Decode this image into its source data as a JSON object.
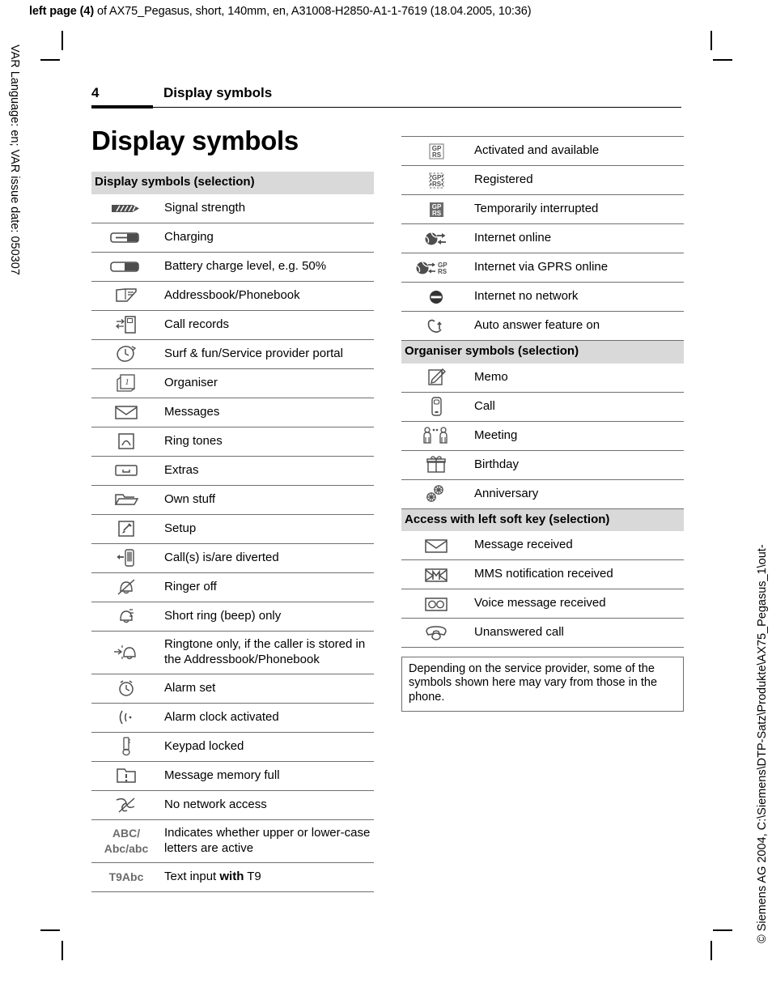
{
  "slug": {
    "prefix_bold": "left page (4)",
    "rest": " of AX75_Pegasus, short, 140mm, en, A31008-H2850-A1-1-7619 (18.04.2005, 10:36)"
  },
  "side": {
    "left": "VAR Language: en; VAR issue date: 050307",
    "right": "© Siemens AG 2004, C:\\Siemens\\DTP-Satz\\Produkte\\AX75_Pegasus_1\\out-"
  },
  "running_head": {
    "page_number": "4",
    "title": "Display symbols"
  },
  "page_title": "Display symbols",
  "colors": {
    "section_header_bg": "#d9d9d9",
    "rule": "#6f6f6f",
    "symbol_text": "#6b6b6b",
    "icon_dark": "#4d4d4d"
  },
  "left_column": {
    "section": "Display symbols (selection)",
    "rows": [
      {
        "icon": "signal-strength-icon",
        "label": "Signal strength"
      },
      {
        "icon": "charging-icon",
        "label": "Charging"
      },
      {
        "icon": "battery-level-icon",
        "label": "Battery charge level, e.g. 50%"
      },
      {
        "icon": "addressbook-icon",
        "label": "Addressbook/Phonebook"
      },
      {
        "icon": "call-records-icon",
        "label": "Call records"
      },
      {
        "icon": "surf-fun-icon",
        "label": "Surf & fun/Service provider portal"
      },
      {
        "icon": "organiser-icon",
        "label": "Organiser"
      },
      {
        "icon": "messages-icon",
        "label": "Messages"
      },
      {
        "icon": "ring-tones-icon",
        "label": "Ring tones"
      },
      {
        "icon": "extras-icon",
        "label": "Extras"
      },
      {
        "icon": "own-stuff-icon",
        "label": "Own stuff"
      },
      {
        "icon": "setup-icon",
        "label": "Setup"
      },
      {
        "icon": "call-diverted-icon",
        "label": "Call(s) is/are diverted"
      },
      {
        "icon": "ringer-off-icon",
        "label": "Ringer off"
      },
      {
        "icon": "short-ring-icon",
        "label": "Short ring (beep) only"
      },
      {
        "icon": "ringtone-filtered-icon",
        "label": "Ringtone only, if the caller is stored in the Addressbook/Phonebook",
        "tall": true
      },
      {
        "icon": "alarm-set-icon",
        "label": "Alarm set"
      },
      {
        "icon": "alarm-clock-icon",
        "label": "Alarm clock activated"
      },
      {
        "icon": "keypad-locked-icon",
        "label": "Keypad locked"
      },
      {
        "icon": "message-memory-full-icon",
        "label": "Message memory full"
      },
      {
        "icon": "no-network-icon",
        "label": "No network access"
      },
      {
        "icon": "case-indicator-text",
        "sym_line1": "ABC/",
        "sym_line2": "Abc/abc",
        "label": "Indicates whether upper or lower-case letters are active",
        "tall": true
      },
      {
        "icon": "t9-text",
        "sym_line1": "T9Abc",
        "label_pre": "Text input ",
        "label_bold": "with",
        "label_post": " T9"
      }
    ]
  },
  "right_column": {
    "rows_top": [
      {
        "icon": "gprs-available-icon",
        "label": "Activated and available"
      },
      {
        "icon": "gprs-registered-icon",
        "label": "Registered"
      },
      {
        "icon": "gprs-interrupted-icon",
        "label": "Temporarily interrupted"
      },
      {
        "icon": "internet-online-icon",
        "label": "Internet online"
      },
      {
        "icon": "internet-gprs-online-icon",
        "label": "Internet via GPRS online"
      },
      {
        "icon": "internet-no-network-icon",
        "label": "Internet no network"
      },
      {
        "icon": "auto-answer-icon",
        "label": "Auto answer feature on"
      }
    ],
    "section_organiser": "Organiser symbols (selection)",
    "rows_organiser": [
      {
        "icon": "memo-icon",
        "label": "Memo"
      },
      {
        "icon": "call-icon",
        "label": "Call"
      },
      {
        "icon": "meeting-icon",
        "label": "Meeting"
      },
      {
        "icon": "birthday-icon",
        "label": "Birthday"
      },
      {
        "icon": "anniversary-icon",
        "label": "Anniversary"
      }
    ],
    "section_softkey": "Access with left soft key (selection)",
    "rows_softkey": [
      {
        "icon": "message-received-icon",
        "label": "Message received"
      },
      {
        "icon": "mms-notification-icon",
        "label": "MMS notification received"
      },
      {
        "icon": "voice-message-icon",
        "label": "Voice message received"
      },
      {
        "icon": "unanswered-call-icon",
        "label": "Unanswered call"
      }
    ],
    "note": "Depending on the service provider, some of the symbols shown here may vary from those in the phone."
  },
  "gprs_labels": {
    "gp": "GP",
    "rs": "RS"
  }
}
